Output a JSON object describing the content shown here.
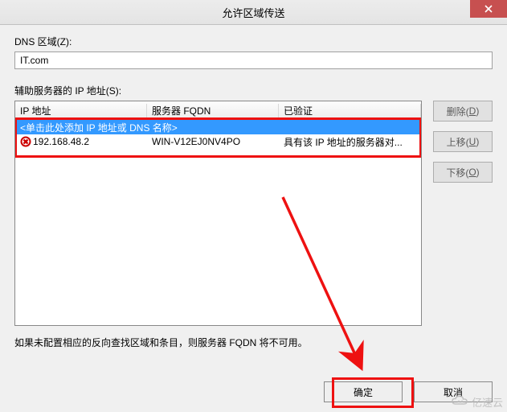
{
  "titlebar": {
    "title": "允许区域传送"
  },
  "dns_zone": {
    "label": "DNS 区域(Z):",
    "value": "IT.com"
  },
  "aux_label": "辅助服务器的 IP 地址(S):",
  "columns": {
    "ip": "IP 地址",
    "fqdn": "服务器 FQDN",
    "validated": "已验证"
  },
  "rows": {
    "placeholder": "<单击此处添加 IP 地址或 DNS 名称>",
    "r0": {
      "ip": "192.168.48.2",
      "fqdn": "WIN-V12EJ0NV4PO",
      "validated": "具有该 IP 地址的服务器对..."
    }
  },
  "side_buttons": {
    "delete": {
      "label": "删除(",
      "mn": "D",
      "after": ")"
    },
    "up": {
      "label": "上移(",
      "mn": "U",
      "after": ")"
    },
    "down": {
      "label": "下移(",
      "mn": "O",
      "after": ")"
    }
  },
  "hint": "如果未配置相应的反向查找区域和条目，则服务器 FQDN 将不可用。",
  "footer": {
    "ok": "确定",
    "cancel": "取消"
  },
  "watermark": "亿速云",
  "annotation": {
    "arrow_color": "#e11"
  }
}
